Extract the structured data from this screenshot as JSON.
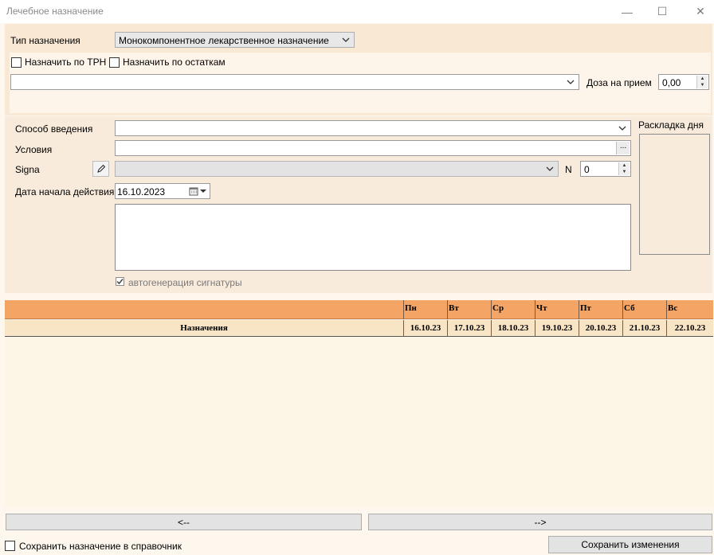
{
  "window": {
    "title": "Лечебное назначение",
    "minimize": "—",
    "maximize": "☐",
    "close": "✕"
  },
  "form": {
    "type_label": "Тип назначения",
    "type_value": "Монокомпонентное лекарственное назначение",
    "assign_trn_label": "Назначить по ТРН",
    "assign_stock_label": "Назначить по остаткам",
    "drug_value": "",
    "dose_label": "Доза на прием",
    "dose_value": "0,00",
    "route_label": "Способ введения",
    "route_value": "",
    "conditions_label": "Условия",
    "conditions_value": "",
    "conditions_browse": "...",
    "signa_label": "Signa",
    "signa_value": "",
    "n_label": "N",
    "n_value": "0",
    "start_date_label": "Дата начала действия",
    "start_date_value": "16.10.2023",
    "notes_value": "",
    "autogen_label": "автогенерация сигнатуры",
    "day_layout_label": "Раскладка дня"
  },
  "grid": {
    "row_header": "Назначения",
    "days": [
      {
        "name": "Пн",
        "date": "16.10.23"
      },
      {
        "name": "Вт",
        "date": "17.10.23"
      },
      {
        "name": "Ср",
        "date": "18.10.23"
      },
      {
        "name": "Чт",
        "date": "19.10.23"
      },
      {
        "name": "Пт",
        "date": "20.10.23"
      },
      {
        "name": "Сб",
        "date": "21.10.23"
      },
      {
        "name": "Вс",
        "date": "22.10.23"
      }
    ]
  },
  "nav": {
    "prev_label": "<--",
    "next_label": "-->"
  },
  "footer": {
    "save_to_reference_label": "Сохранить назначение в справочник",
    "save_button_label": "Сохранить изменения"
  },
  "icons": {
    "pencil": "pencil-icon",
    "calendar": "calendar-icon",
    "chevron": "chevron-down-icon",
    "check": "checkmark-icon"
  },
  "colors": {
    "grid_header": "#f4a566",
    "grid_row": "#f8e5c6",
    "panel": "#f8ebdb",
    "panel_light": "#fdf5ea"
  }
}
